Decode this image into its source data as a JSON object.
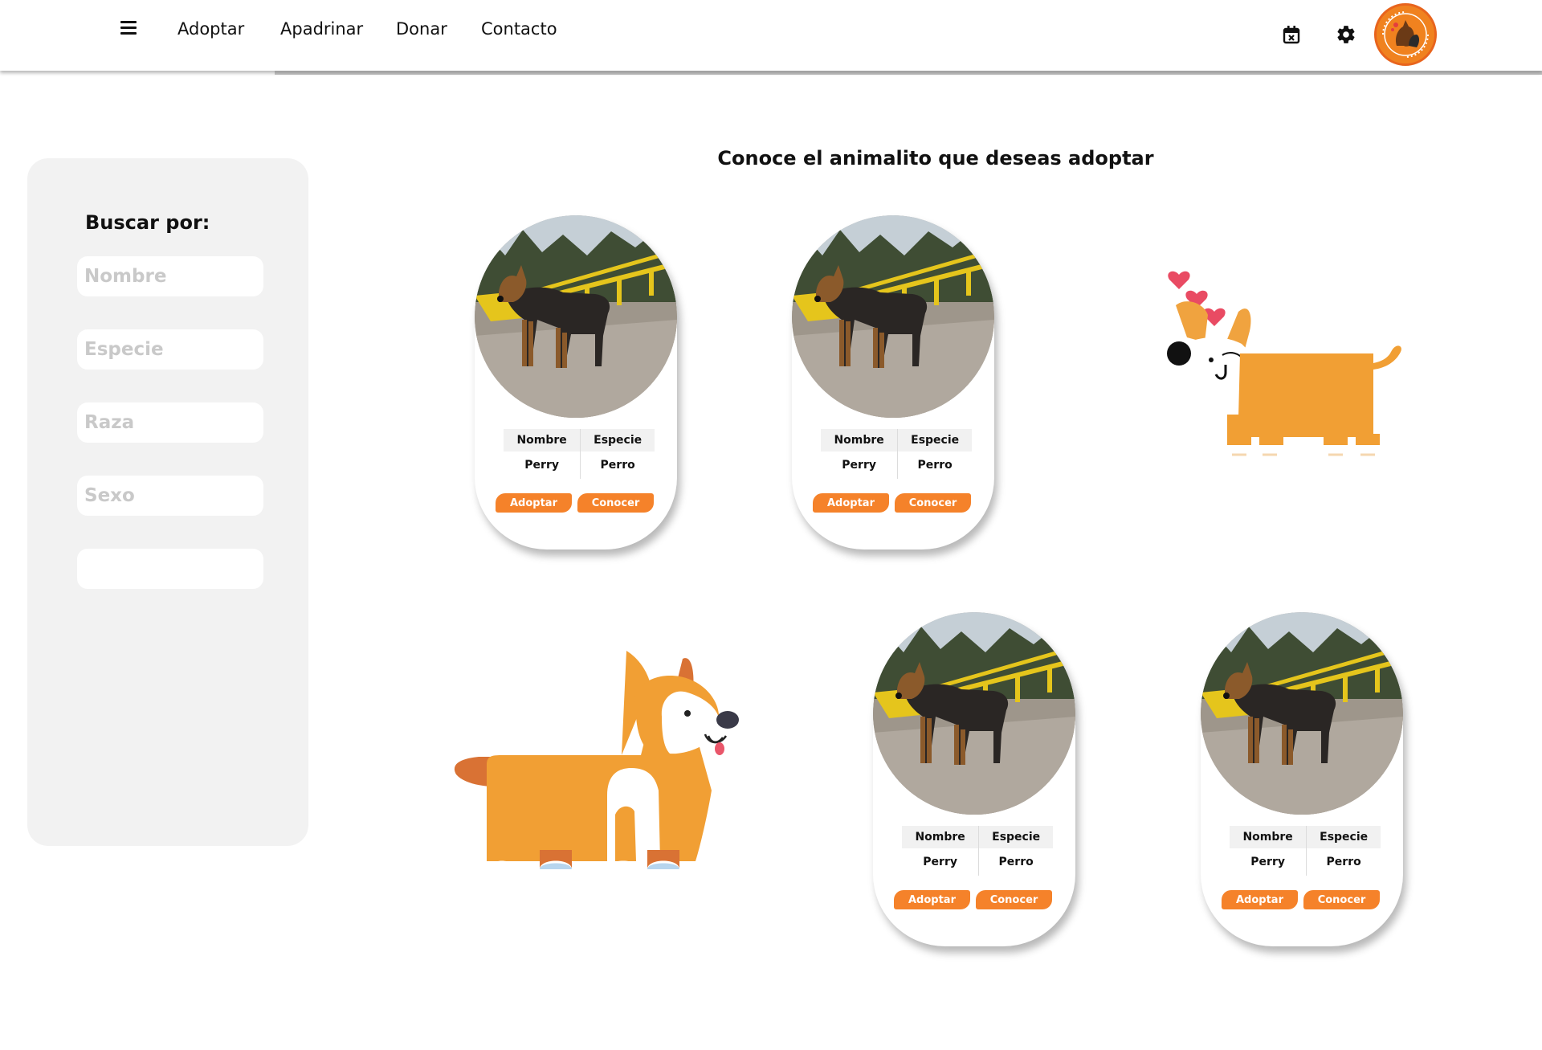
{
  "header": {
    "menu_icon": "hamburger-menu-icon",
    "nav": [
      {
        "label": "Adoptar"
      },
      {
        "label": "Apadrinar"
      },
      {
        "label": "Donar"
      },
      {
        "label": "Contacto"
      }
    ],
    "icons": [
      "calendar-x-icon",
      "gear-icon"
    ],
    "logo_icon": "dog-and-cat-logo"
  },
  "sidebar": {
    "title": "Buscar por:",
    "filters": [
      {
        "placeholder": "Nombre",
        "value": ""
      },
      {
        "placeholder": "Especie",
        "value": ""
      },
      {
        "placeholder": "Raza",
        "value": ""
      },
      {
        "placeholder": "Sexo",
        "value": ""
      },
      {
        "placeholder": "",
        "value": ""
      }
    ]
  },
  "main": {
    "title": "Conoce el animalito que deseas adoptar",
    "cards": [
      {
        "col_name": "Nombre",
        "col_species": "Especie",
        "name": "Perry",
        "species": "Perro",
        "adopt_label": "Adoptar",
        "know_label": "Conocer"
      },
      {
        "col_name": "Nombre",
        "col_species": "Especie",
        "name": "Perry",
        "species": "Perro",
        "adopt_label": "Adoptar",
        "know_label": "Conocer"
      },
      {
        "col_name": "Nombre",
        "col_species": "Especie",
        "name": "Perry",
        "species": "Perro",
        "adopt_label": "Adoptar",
        "know_label": "Conocer"
      },
      {
        "col_name": "Nombre",
        "col_species": "Especie",
        "name": "Perry",
        "species": "Perro",
        "adopt_label": "Adoptar",
        "know_label": "Conocer"
      }
    ]
  },
  "colors": {
    "accent": "#f5822a",
    "sidebar_bg": "#f2f2f2",
    "corgi": "#f19f34",
    "heart": "#e94b63"
  }
}
